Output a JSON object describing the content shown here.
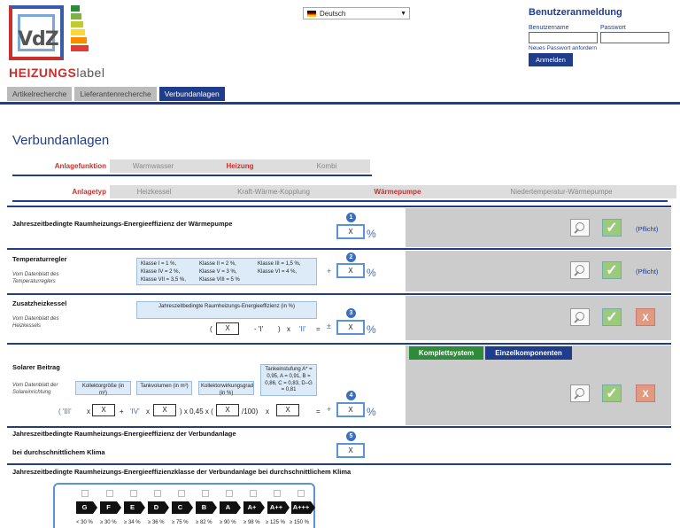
{
  "logo": {
    "brand_box": "VdZ",
    "label_bold": "HEIZUNGS",
    "label_light": "label"
  },
  "language": {
    "selected": "Deutsch"
  },
  "login": {
    "title": "Benutzeranmeldung",
    "username_label": "Benutzername",
    "password_label": "Passwort",
    "forgot": "Neues Passwort anfordern",
    "submit": "Anmelden"
  },
  "nav": {
    "tabs": [
      "Artikelrecherche",
      "Lieferantenrecherche",
      "Verbundanlagen"
    ],
    "active": "Verbundanlagen"
  },
  "page_title": "Verbundanlagen",
  "anlagefunktion": {
    "label": "Anlagefunktion",
    "options": [
      "Warmwasser",
      "Heizung",
      "Kombi"
    ],
    "selected": "Heizung"
  },
  "anlagetyp": {
    "label": "Anlagetyp",
    "options": [
      "Heizkessel",
      "Kraft-Wärme-Kopplung",
      "Wärmepumpe",
      "Niedertemperatur-Wärmepumpe"
    ],
    "selected": "Wärmepumpe"
  },
  "sections": {
    "s1": {
      "title": "Jahreszeitbedingte Raumheizungs-Energieeffizienz der Wärmepumpe",
      "num": "1",
      "value": "X",
      "unit": "%",
      "pflicht": "(Pflicht)"
    },
    "s2": {
      "title": "Temperaturregler",
      "sub": "Vom Datenblatt des Temperaturreglers",
      "num": "2",
      "value": "X",
      "unit": "%",
      "op": "+",
      "pflicht": "(Pflicht)",
      "classes": [
        "Klasse I = 1 %,",
        "Klasse II = 2 %,",
        "Klasse III = 1,5 %,",
        "Klasse IV = 2 %,",
        "Klasse V = 3 %,",
        "Klasse VI = 4 %,",
        "Klasse VII = 3,5 %,",
        "Klasse VIII = 5 %"
      ]
    },
    "s3": {
      "title": "Zusatzheizkessel",
      "sub": "Vom Datenblatt des Heizkessels",
      "num": "3",
      "value": "X",
      "unit": "%",
      "info": "Jahreszeitbedingte Raumheizungs-Energieeffizienz (in %)",
      "open": "(",
      "inner": "X",
      "minus": "- 'I'",
      "close": ")",
      "times": "x",
      "factor": "'II'",
      "eq": "=",
      "op": "±"
    },
    "s4": {
      "title": "Solarer Beitrag",
      "sub": "Vom Datenblatt der Solareinrichtung",
      "num": "4",
      "value": "X",
      "unit": "%",
      "op": "+",
      "tabs": [
        "Komplettsystem",
        "Einzelkomponenten"
      ],
      "info1": "Kollektorgröße (in m²)",
      "info2": "Tankvolumen (in m³)",
      "info3": "Kollektorwirkungsgrad (in %)",
      "info4": "Tankeinstufung A* = 0,95, A = 0,91, B = 0,86, C = 0,83, D–G = 0,81",
      "f_iii": "( 'III'",
      "f_x1": "x",
      "f_plus": "+",
      "f_iv": "'IV'",
      "f_x2": "x",
      "f_mid": ") x 0,45 x (",
      "f_div": "/100)",
      "f_x3": "x",
      "f_eq": "=",
      "v1": "X",
      "v2": "X",
      "v3": "X",
      "v4": "X"
    },
    "s5": {
      "title": "Jahreszeitbedingte Raumheizungs-Energieeffizienz der Verbundanlage",
      "sub": "bei durchschnittlichem Klima",
      "num": "5",
      "value": "X"
    },
    "s6": {
      "title": "Jahreszeitbedingte Raumheizungs-Energieeffizienzklasse der Verbundanlage bei durchschnittlichem Klima",
      "classes": [
        "G",
        "F",
        "E",
        "D",
        "C",
        "B",
        "A",
        "A+",
        "A++",
        "A+++"
      ],
      "thresholds": [
        "< 30 %",
        "≥ 30 %",
        "≥ 34 %",
        "≥ 36 %",
        "≥ 75 %",
        "≥ 82 %",
        "≥ 90 %",
        "≥ 98 %",
        "≥ 125 %",
        "≥ 150 %"
      ]
    }
  },
  "colors": {
    "primary": "#1f3d8a",
    "accent_red": "#c9302c",
    "input_blue": "#5a93d6",
    "check_green": "#9cca7c",
    "reject_orange": "#e09a80"
  }
}
